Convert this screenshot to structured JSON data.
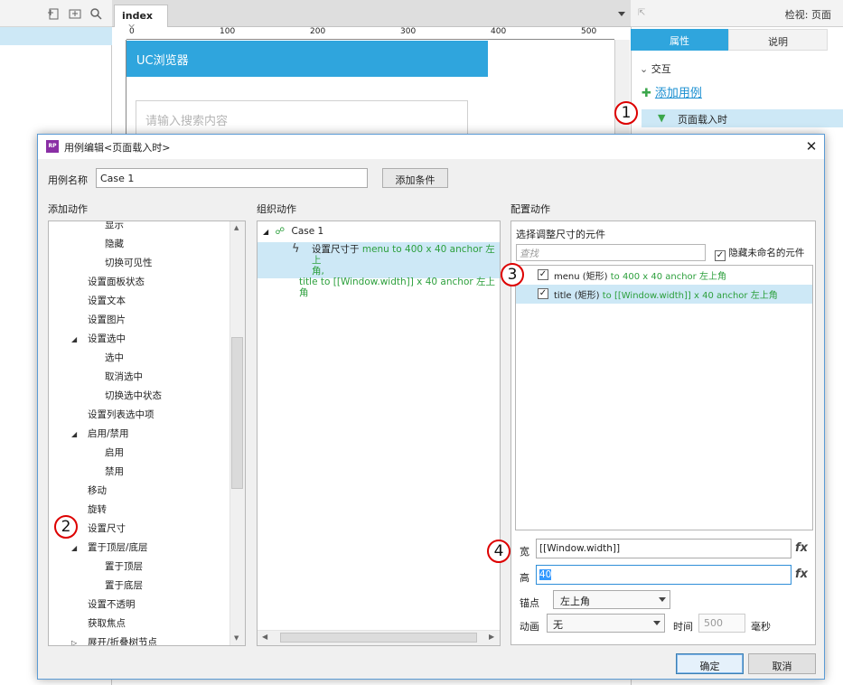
{
  "app": {
    "tab_label": "index",
    "ruler_marks": [
      "0",
      "100",
      "200",
      "300",
      "400",
      "500"
    ],
    "canvas_header_text": "UC浏览器",
    "canvas_search_placeholder": "请输入搜索内容",
    "right_panel_title": "检视: 页面",
    "right_tab_properties": "属性",
    "right_tab_notes": "说明",
    "interaction_label": "交互",
    "add_case_link": "添加用例",
    "event_label": "页面载入时"
  },
  "dialog": {
    "title": "用例编辑<页面载入时>",
    "case_name_label": "用例名称",
    "case_name_value": "Case 1",
    "add_condition_label": "添加条件",
    "add_action_title": "添加动作",
    "organize_action_title": "组织动作",
    "configure_action_title": "配置动作",
    "left_list": [
      {
        "label": "显示",
        "level": 2,
        "toggle": ""
      },
      {
        "label": "隐藏",
        "level": 2,
        "toggle": ""
      },
      {
        "label": "切换可见性",
        "level": 2,
        "toggle": ""
      },
      {
        "label": "设置面板状态",
        "level": 1,
        "toggle": ""
      },
      {
        "label": "设置文本",
        "level": 1,
        "toggle": ""
      },
      {
        "label": "设置图片",
        "level": 1,
        "toggle": ""
      },
      {
        "label": "设置选中",
        "level": 1,
        "toggle": "◢"
      },
      {
        "label": "选中",
        "level": 2,
        "toggle": ""
      },
      {
        "label": "取消选中",
        "level": 2,
        "toggle": ""
      },
      {
        "label": "切换选中状态",
        "level": 2,
        "toggle": ""
      },
      {
        "label": "设置列表选中项",
        "level": 1,
        "toggle": ""
      },
      {
        "label": "启用/禁用",
        "level": 1,
        "toggle": "◢"
      },
      {
        "label": "启用",
        "level": 2,
        "toggle": ""
      },
      {
        "label": "禁用",
        "level": 2,
        "toggle": ""
      },
      {
        "label": "移动",
        "level": 1,
        "toggle": ""
      },
      {
        "label": "旋转",
        "level": 1,
        "toggle": ""
      },
      {
        "label": "设置尺寸",
        "level": 1,
        "toggle": ""
      },
      {
        "label": "置于顶层/底层",
        "level": 1,
        "toggle": "◢"
      },
      {
        "label": "置于顶层",
        "level": 2,
        "toggle": ""
      },
      {
        "label": "置于底层",
        "level": 2,
        "toggle": ""
      },
      {
        "label": "设置不透明",
        "level": 1,
        "toggle": ""
      },
      {
        "label": "获取焦点",
        "level": 1,
        "toggle": ""
      },
      {
        "label": "展开/折叠树节点",
        "level": 1,
        "toggle": "▷"
      }
    ],
    "case_node_label": "Case 1",
    "action_prefix": "设置尺寸于",
    "action_line1": "menu to 400 x 40 anchor 左上",
    "action_line2": "角,",
    "action_line3": "title to [[Window.width]] x 40 anchor 左上角",
    "select_widget_title": "选择调整尺寸的元件",
    "filter_placeholder": "查找",
    "hide_unnamed_label": "隐藏未命名的元件",
    "elements": [
      {
        "name": "menu (矩形)",
        "detail": "to 400 x 40 anchor 左上角",
        "checked": "✓"
      },
      {
        "name": "title (矩形)",
        "detail": "to [[Window.width]] x 40 anchor 左上角",
        "checked": "✓"
      }
    ],
    "width_label": "宽",
    "width_value": "[[Window.width]]",
    "height_label": "高",
    "height_value": "40",
    "fx_label": "fx",
    "anchor_label": "锚点",
    "anchor_value": "左上角",
    "animation_label": "动画",
    "animation_value": "无",
    "time_label": "时间",
    "time_value": "500",
    "ms_label": "毫秒",
    "ok_label": "确定",
    "cancel_label": "取消",
    "close_glyph": "✕"
  },
  "badges": [
    "1",
    "2",
    "3",
    "4"
  ],
  "colors": {
    "accent": "#2fa5dd",
    "selection": "#cde8f6",
    "green_text": "#2c9f3c",
    "badge_border": "#dd0000"
  }
}
